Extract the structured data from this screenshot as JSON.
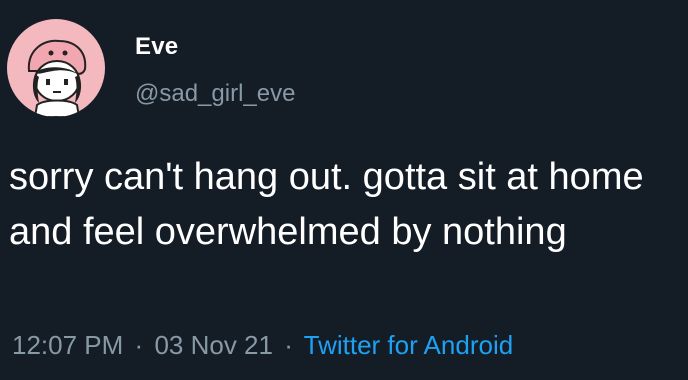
{
  "tweet": {
    "display_name": "Eve",
    "handle": "@sad_girl_eve",
    "text": "sorry can't hang out. gotta sit at home and feel overwhelmed by nothing",
    "time": "12:07 PM",
    "date": "03 Nov 21",
    "source": "Twitter for Android",
    "separator": "·",
    "avatar_icon": "cartoon-girl-avatar-icon"
  },
  "colors": {
    "background": "#141c26",
    "avatar_bg": "#f4b8bf",
    "secondary_text": "#8899a6",
    "link": "#1da1f2"
  }
}
